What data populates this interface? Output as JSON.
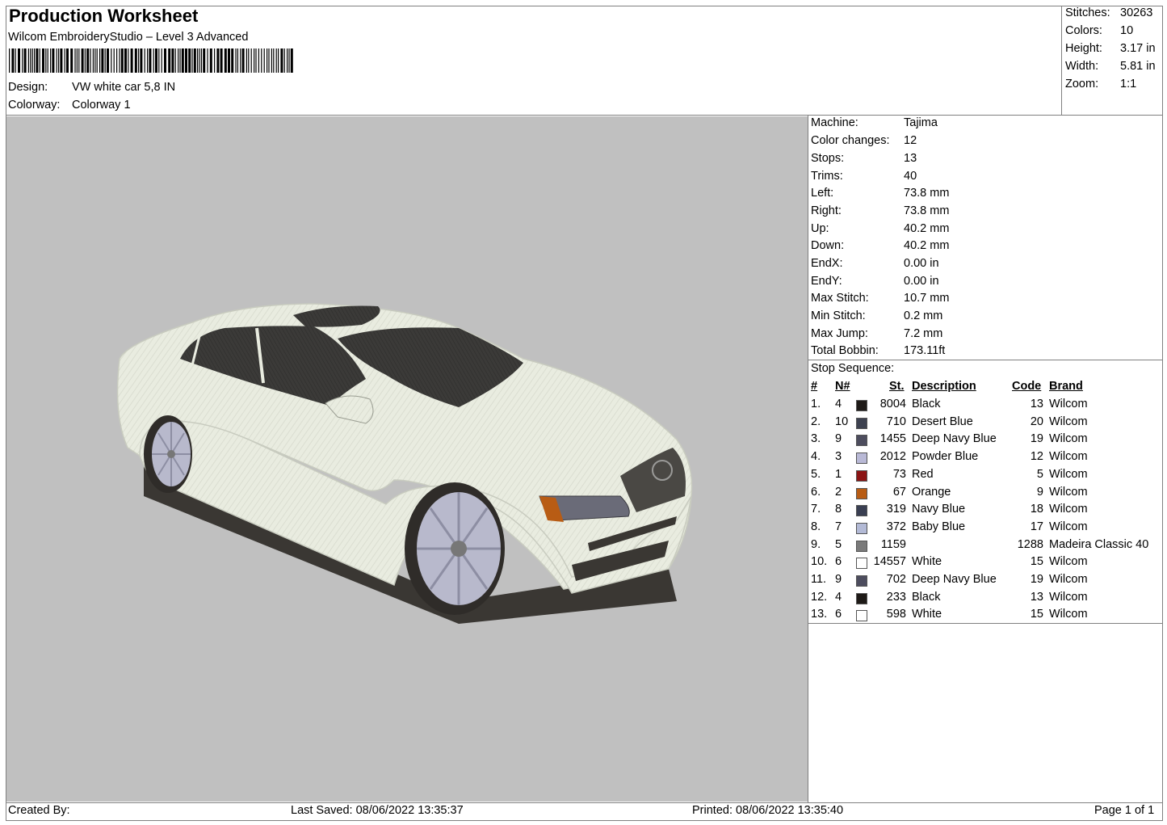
{
  "header": {
    "title": "Production Worksheet",
    "subtitle": "Wilcom EmbroideryStudio – Level 3 Advanced",
    "design_label": "Design:",
    "design_value": "VW white car 5,8 IN",
    "colorway_label": "Colorway:",
    "colorway_value": "Colorway 1"
  },
  "summary": [
    {
      "label": "Stitches:",
      "value": "30263"
    },
    {
      "label": "Colors:",
      "value": "10"
    },
    {
      "label": "Height:",
      "value": "3.17 in"
    },
    {
      "label": "Width:",
      "value": "5.81 in"
    },
    {
      "label": "Zoom:",
      "value": "1:1"
    }
  ],
  "machine_info": [
    {
      "label": "Machine:",
      "value": "Tajima"
    },
    {
      "label": "Color changes:",
      "value": "12"
    },
    {
      "label": "Stops:",
      "value": "13"
    },
    {
      "label": "Trims:",
      "value": "40"
    },
    {
      "label": "Left:",
      "value": "73.8 mm"
    },
    {
      "label": "Right:",
      "value": "73.8 mm"
    },
    {
      "label": "Up:",
      "value": "40.2 mm"
    },
    {
      "label": "Down:",
      "value": "40.2 mm"
    },
    {
      "label": "EndX:",
      "value": "0.00 in"
    },
    {
      "label": "EndY:",
      "value": "0.00 in"
    },
    {
      "label": "Max Stitch:",
      "value": "10.7 mm"
    },
    {
      "label": "Min Stitch:",
      "value": "0.2 mm"
    },
    {
      "label": "Max Jump:",
      "value": "7.2 mm"
    },
    {
      "label": "Total Bobbin:",
      "value": "173.11ft"
    }
  ],
  "stop_sequence": {
    "title": "Stop Sequence:",
    "headers": {
      "idx": "#",
      "n": "N#",
      "st": "St.",
      "desc": "Description",
      "code": "Code",
      "brand": "Brand"
    },
    "rows": [
      {
        "idx": "1.",
        "n": "4",
        "color": "#1e1a17",
        "st": "8004",
        "desc": "Black",
        "code": "13",
        "brand": "Wilcom"
      },
      {
        "idx": "2.",
        "n": "10",
        "color": "#3e4250",
        "st": "710",
        "desc": "Desert Blue",
        "code": "20",
        "brand": "Wilcom"
      },
      {
        "idx": "3.",
        "n": "9",
        "color": "#4d4d5e",
        "st": "1455",
        "desc": "Deep Navy Blue",
        "code": "19",
        "brand": "Wilcom"
      },
      {
        "idx": "4.",
        "n": "3",
        "color": "#b9b9d6",
        "st": "2012",
        "desc": "Powder Blue",
        "code": "12",
        "brand": "Wilcom"
      },
      {
        "idx": "5.",
        "n": "1",
        "color": "#8b1414",
        "st": "73",
        "desc": "Red",
        "code": "5",
        "brand": "Wilcom"
      },
      {
        "idx": "6.",
        "n": "2",
        "color": "#b85c14",
        "st": "67",
        "desc": "Orange",
        "code": "9",
        "brand": "Wilcom"
      },
      {
        "idx": "7.",
        "n": "8",
        "color": "#3a3f52",
        "st": "319",
        "desc": "Navy Blue",
        "code": "18",
        "brand": "Wilcom"
      },
      {
        "idx": "8.",
        "n": "7",
        "color": "#b3bad6",
        "st": "372",
        "desc": "Baby Blue",
        "code": "17",
        "brand": "Wilcom"
      },
      {
        "idx": "9.",
        "n": "5",
        "color": "#7a7a7a",
        "st": "1159",
        "desc": "",
        "code": "1288",
        "brand": "Madeira Classic 40"
      },
      {
        "idx": "10.",
        "n": "6",
        "color": "#ffffff",
        "st": "14557",
        "desc": "White",
        "code": "15",
        "brand": "Wilcom"
      },
      {
        "idx": "11.",
        "n": "9",
        "color": "#4d4d5e",
        "st": "702",
        "desc": "Deep Navy Blue",
        "code": "19",
        "brand": "Wilcom"
      },
      {
        "idx": "12.",
        "n": "4",
        "color": "#1e1a17",
        "st": "233",
        "desc": "Black",
        "code": "13",
        "brand": "Wilcom"
      },
      {
        "idx": "13.",
        "n": "6",
        "color": "#ffffff",
        "st": "598",
        "desc": "White",
        "code": "15",
        "brand": "Wilcom"
      }
    ]
  },
  "footer": {
    "created_by": "Created By:",
    "last_saved": "Last Saved: 08/06/2022 13:35:37",
    "printed": "Printed: 08/06/2022 13:35:40",
    "page": "Page 1 of 1"
  },
  "colors": {
    "preview_bg": "#c0c0c0",
    "car_body": "#e9ece0",
    "glass": "#3b3a38",
    "rim": "#b8b9cc",
    "border": "#808080"
  }
}
